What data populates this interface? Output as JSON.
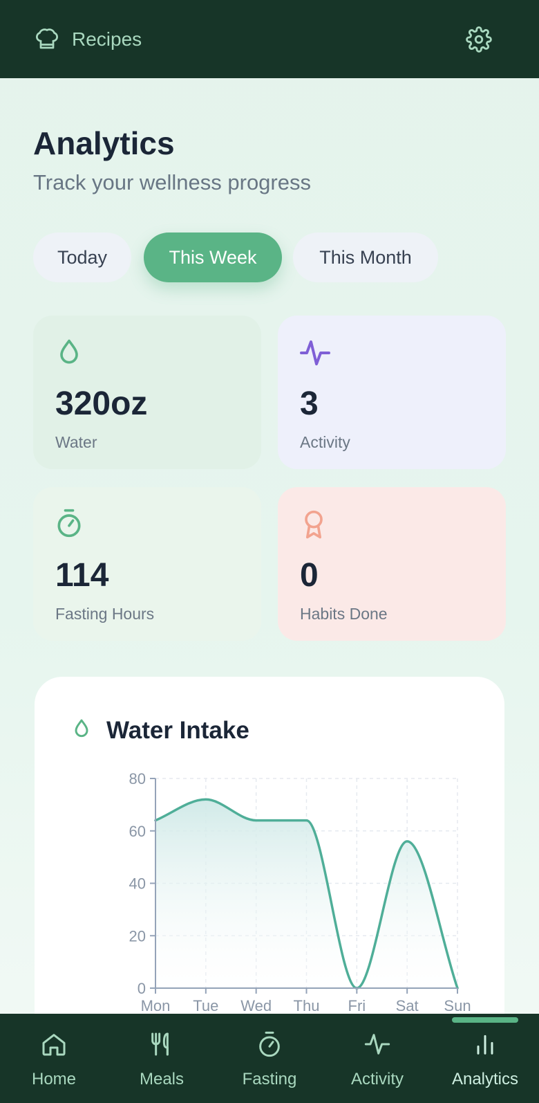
{
  "topbar": {
    "brand_label": "Recipes",
    "brand_icon": "chef-hat-icon",
    "settings_icon": "gear-icon"
  },
  "header": {
    "title": "Analytics",
    "subtitle": "Track your wellness progress"
  },
  "period_tabs": [
    {
      "label": "Today",
      "active": false
    },
    {
      "label": "This Week",
      "active": true
    },
    {
      "label": "This Month",
      "active": false
    }
  ],
  "stats": {
    "water": {
      "value": "320oz",
      "label": "Water",
      "icon": "water-drop-icon"
    },
    "activity": {
      "value": "3",
      "label": "Activity",
      "icon": "pulse-icon"
    },
    "fasting": {
      "value": "114",
      "label": "Fasting Hours",
      "icon": "stopwatch-icon"
    },
    "habits": {
      "value": "0",
      "label": "Habits Done",
      "icon": "award-icon"
    }
  },
  "water_chart": {
    "title": "Water Intake",
    "icon": "water-drop-icon"
  },
  "chart_data": {
    "type": "area",
    "title": "Water Intake",
    "categories": [
      "Mon",
      "Tue",
      "Wed",
      "Thu",
      "Fri",
      "Sat",
      "Sun"
    ],
    "values": [
      64,
      72,
      64,
      64,
      0,
      56,
      0
    ],
    "ylim": [
      0,
      80
    ],
    "yticks": [
      0,
      20,
      40,
      60,
      80
    ],
    "grid": true,
    "colors": {
      "line": "#4fae98",
      "fill": "#cfe9e7"
    }
  },
  "colors": {
    "topbar": "#173528",
    "accent": "#5ab486",
    "nav_text": "#a9d8bf",
    "activity_purple": "#7f5fd6",
    "habits_salmon": "#f2a38f"
  },
  "bottom_nav": {
    "items": [
      {
        "label": "Home",
        "icon": "home-icon",
        "active": false
      },
      {
        "label": "Meals",
        "icon": "utensils-icon",
        "active": false
      },
      {
        "label": "Fasting",
        "icon": "stopwatch-icon",
        "active": false
      },
      {
        "label": "Activity",
        "icon": "pulse-icon",
        "active": false
      },
      {
        "label": "Analytics",
        "icon": "bar-chart-icon",
        "active": true
      }
    ]
  }
}
